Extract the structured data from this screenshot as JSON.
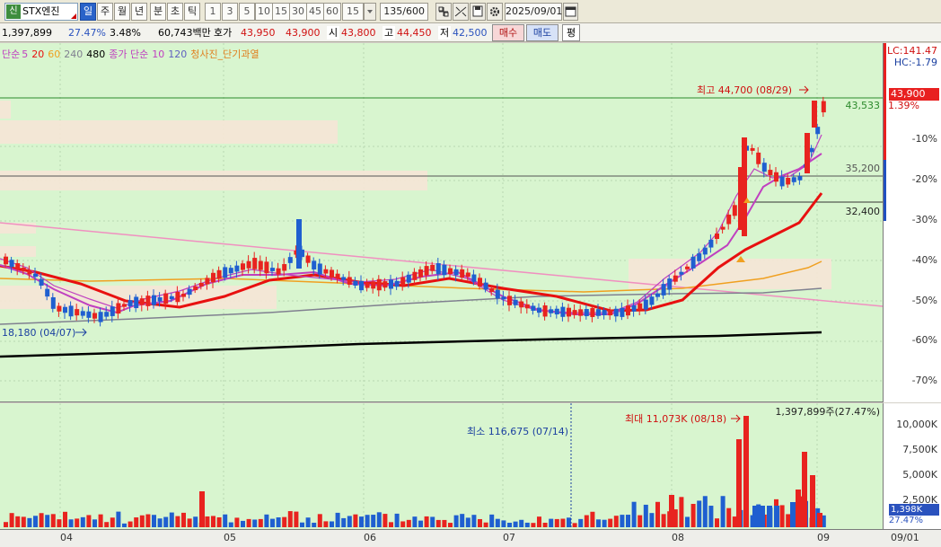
{
  "toolbar": {
    "stock_badge": "신",
    "stock_name": "STX엔진",
    "periods": [
      {
        "label": "일",
        "active": true
      },
      {
        "label": "주",
        "active": false
      },
      {
        "label": "월",
        "active": false
      },
      {
        "label": "년",
        "active": false
      },
      {
        "label": "분",
        "active": false
      },
      {
        "label": "초",
        "active": false
      },
      {
        "label": "틱",
        "active": false
      }
    ],
    "intervals": [
      "1",
      "3",
      "5",
      "10",
      "15",
      "30",
      "45",
      "60"
    ],
    "interval_select": "15",
    "count": "135/600",
    "date": "2025/09/01"
  },
  "quote": {
    "volume": "1,397,899",
    "pct1": "27.47%",
    "pct2": "3.48%",
    "amount": "60,743백만",
    "hoga_label": "호가",
    "ask": "43,950",
    "bid": "43,900",
    "open_label": "시",
    "open": "43,800",
    "high_label": "고",
    "high": "44,450",
    "low_label": "저",
    "low": "42,500",
    "buy_label": "매수",
    "sell_label": "매도",
    "eval_label": "평"
  },
  "legend": {
    "sma_label": "단순",
    "ma5": "5",
    "ma20": "20",
    "ma60": "60",
    "ma240": "240",
    "ma480": "480",
    "vol_label": "종가 단순",
    "vma10": "10",
    "vma120": "120",
    "pattern_label": "청사진_단기과열"
  },
  "colors": {
    "up": "#e8231f",
    "down": "#1f5fd0",
    "ma5": "#c040c0",
    "ma20": "#e81010",
    "ma60": "#f0a020",
    "ma240": "#808090",
    "ma480": "#000000",
    "trend": "#f090c0",
    "bg": "#d8f5cf"
  },
  "annotations": {
    "max_price": "최고 44,700 (08/29)",
    "min_price": "18,180 (04/07)",
    "max_volume": "최대 11,073K (08/18)",
    "min_volume": "최소 116,675 (07/14)",
    "lc": "LC:141.47",
    "hc": "HC:-1.79",
    "current_price": "43,900",
    "current_pct": "1.39%",
    "line_43533": "43,533",
    "line_35200": "35,200",
    "line_32400": "32,400",
    "vol_current": "1,397,899주(27.47%)",
    "vol_badge": "1,398K",
    "vol_pct": "27.47%"
  },
  "price_axis": [
    "-10%",
    "-20%",
    "-30%",
    "-40%",
    "-50%",
    "-60%",
    "-70%"
  ],
  "volume_axis": [
    "10,000K",
    "7,500K",
    "5,000K",
    "2,500K"
  ],
  "date_axis": [
    "04",
    "05",
    "06",
    "07",
    "08",
    "09",
    "09/01"
  ]
}
